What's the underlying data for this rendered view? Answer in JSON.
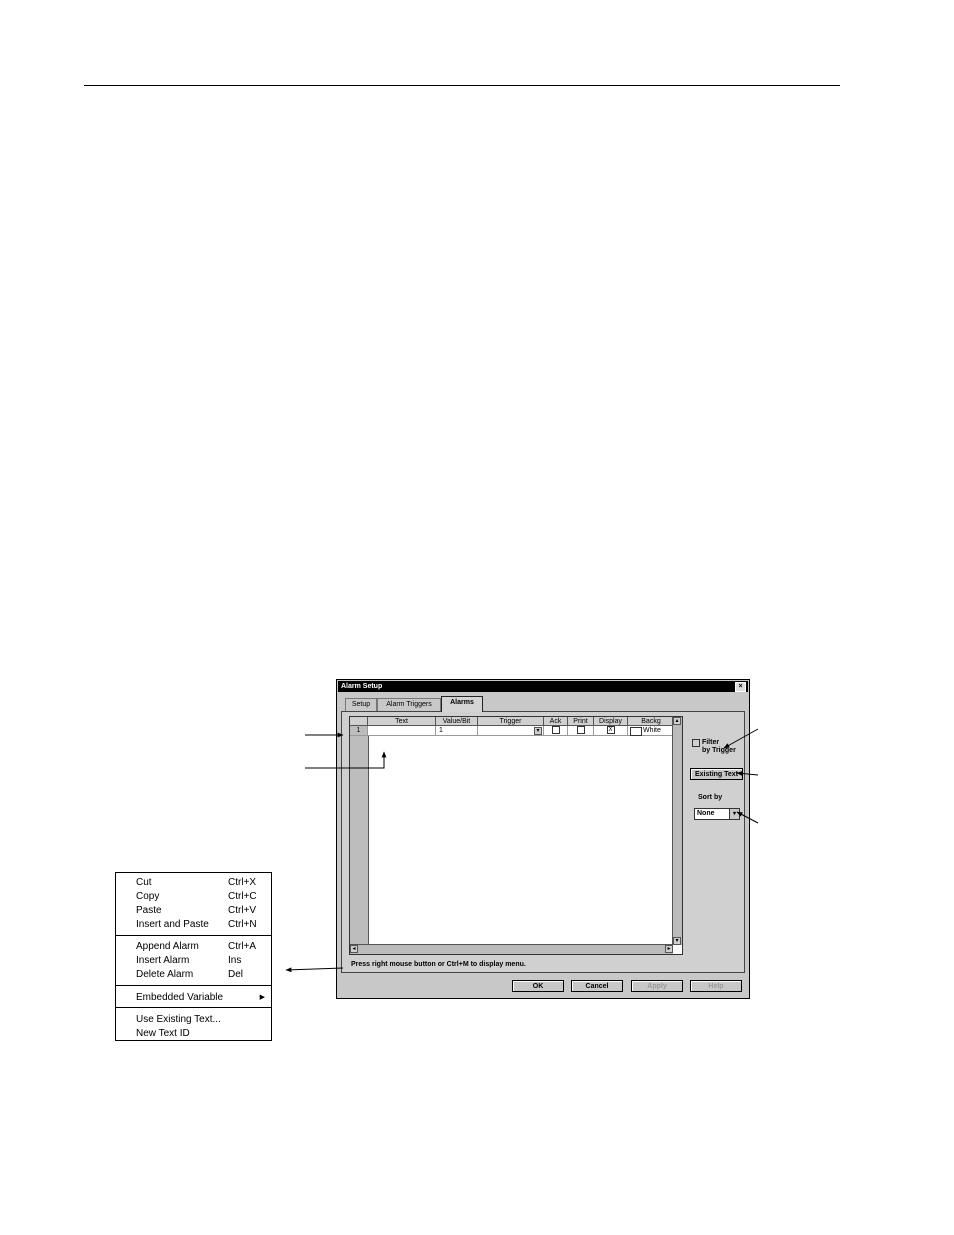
{
  "dialog": {
    "title": "Alarm Setup",
    "close_glyph": "×",
    "tabs": [
      {
        "label": "Setup"
      },
      {
        "label": "Alarm Triggers"
      },
      {
        "label": "Alarms"
      }
    ],
    "grid": {
      "columns": [
        "Text",
        "Value/Bit",
        "Trigger",
        "Ack",
        "Print",
        "Display",
        "Backg"
      ],
      "row": {
        "number": "1",
        "value_bit": "1",
        "display_check": "X",
        "background": "White"
      }
    },
    "filter_checkbox": {
      "label_line1": "Filter",
      "label_line2": "by Trigger"
    },
    "existing_text_button": "Existing Text",
    "sort_by": {
      "label": "Sort by",
      "value": "None"
    },
    "status_text": "Press right mouse button or Ctrl+M to display menu.",
    "buttons": {
      "ok": "OK",
      "cancel": "Cancel",
      "apply": "Apply",
      "help": "Help"
    }
  },
  "context_menu": {
    "group1": [
      {
        "label": "Cut",
        "shortcut": "Ctrl+X"
      },
      {
        "label": "Copy",
        "shortcut": "Ctrl+C"
      },
      {
        "label": "Paste",
        "shortcut": "Ctrl+V"
      },
      {
        "label": "Insert and Paste",
        "shortcut": "Ctrl+N"
      }
    ],
    "group2": [
      {
        "label": "Append Alarm",
        "shortcut": "Ctrl+A"
      },
      {
        "label": "Insert Alarm",
        "shortcut": "Ins"
      },
      {
        "label": "Delete Alarm",
        "shortcut": "Del"
      }
    ],
    "embedded_variable": "Embedded Variable",
    "group4": [
      {
        "label": "Use Existing Text..."
      },
      {
        "label": "New Text ID"
      }
    ]
  },
  "icons": {
    "submenu": "triangle-right-icon",
    "dropdown": "chevron-down-icon",
    "scroll_left": "arrow-left-icon",
    "scroll_right": "arrow-right-icon",
    "scroll_up": "arrow-up-icon",
    "scroll_down": "arrow-down-icon"
  }
}
